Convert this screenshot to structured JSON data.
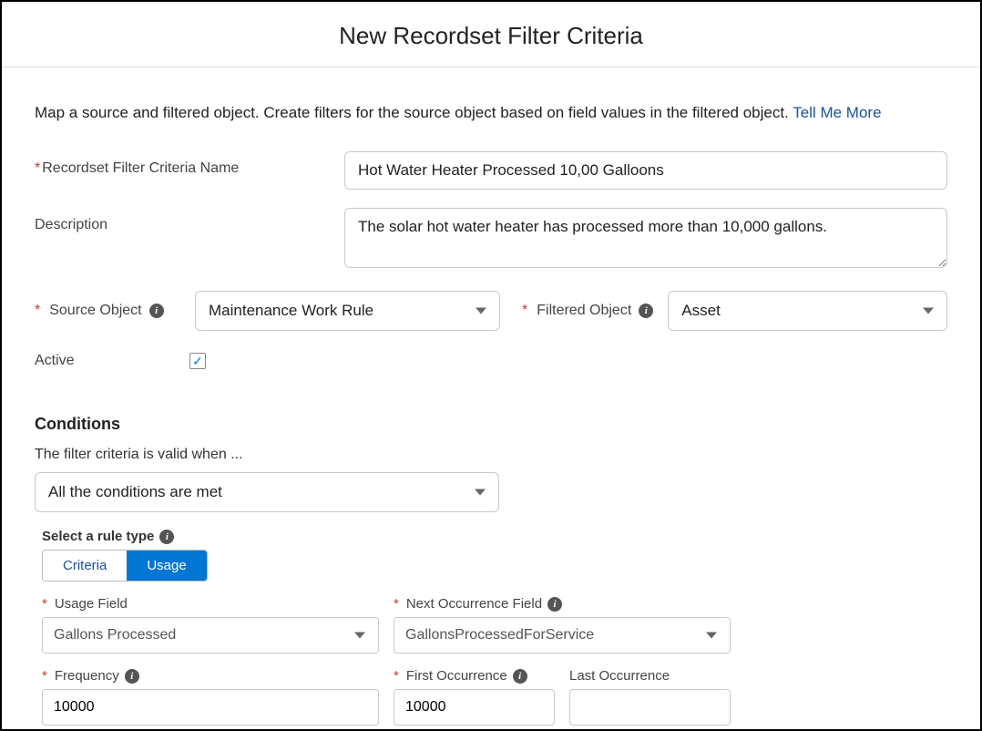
{
  "title": "New Recordset Filter Criteria",
  "intro_text": "Map a source and filtered object. Create filters for the source object based on field values in the filtered object. ",
  "tell_me_more": "Tell Me More",
  "fields": {
    "name_label": "Recordset Filter Criteria Name",
    "name_value": "Hot Water Heater Processed 10,00 Galloons",
    "desc_label": "Description",
    "desc_value": "The solar hot water heater has processed more than 10,000 gallons.",
    "source_label": "Source Object",
    "source_value": "Maintenance Work Rule",
    "filtered_label": "Filtered Object",
    "filtered_value": "Asset",
    "active_label": "Active",
    "active_checked": true
  },
  "conditions": {
    "heading": "Conditions",
    "subtext": "The filter criteria is valid when ...",
    "logic_value": "All the conditions are met",
    "rule_type_label": "Select a rule type",
    "tabs": {
      "criteria": "Criteria",
      "usage": "Usage"
    },
    "usage_field_label": "Usage Field",
    "usage_field_value": "Gallons Processed",
    "next_occ_label": "Next Occurrence Field",
    "next_occ_value": "GallonsProcessedForService",
    "frequency_label": "Frequency",
    "frequency_value": "10000",
    "first_occ_label": "First Occurrence",
    "first_occ_value": "10000",
    "last_occ_label": "Last Occurrence",
    "last_occ_value": ""
  }
}
